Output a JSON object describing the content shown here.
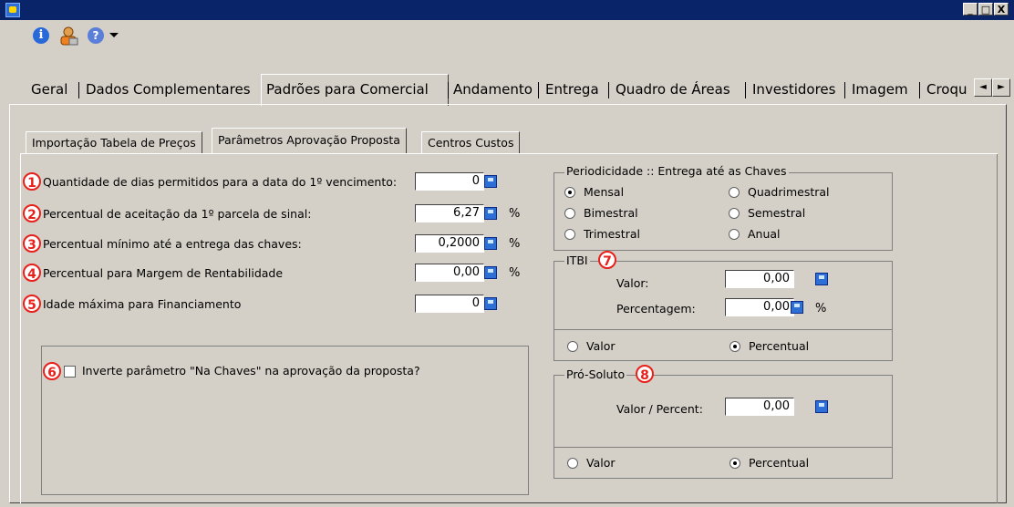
{
  "window": {
    "min_label": "_",
    "max_label": "□",
    "close_label": "X"
  },
  "toolbar": {
    "info_glyph": "i",
    "help_glyph": "?"
  },
  "tabs": [
    {
      "label": "Geral"
    },
    {
      "label": "Dados Complementares"
    },
    {
      "label": "Padrões para Comercial"
    },
    {
      "label": "Andamento"
    },
    {
      "label": "Entrega"
    },
    {
      "label": "Quadro de Áreas"
    },
    {
      "label": "Investidores"
    },
    {
      "label": "Imagem"
    },
    {
      "label": "Croqu"
    }
  ],
  "tab_scroll": {
    "left": "◄",
    "right": "►"
  },
  "subtabs": [
    {
      "label": "Importação Tabela de Preços"
    },
    {
      "label": "Parâmetros Aprovação Proposta"
    },
    {
      "label": "Centros Custos"
    }
  ],
  "fields": [
    {
      "badge": "1",
      "label": "Quantidade de dias permitidos para  a data do 1º vencimento:",
      "value": "0",
      "unit": ""
    },
    {
      "badge": "2",
      "label": "Percentual de aceitação da 1º parcela de sinal:",
      "value": "6,27",
      "unit": "%"
    },
    {
      "badge": "3",
      "label": "Percentual mínimo até a entrega das chaves:",
      "value": "0,2000",
      "unit": "%"
    },
    {
      "badge": "4",
      "label": "Percentual para Margem de Rentabilidade",
      "value": "0,00",
      "unit": "%"
    },
    {
      "badge": "5",
      "label": "Idade máxima para Financiamento",
      "value": "0",
      "unit": ""
    }
  ],
  "invert": {
    "badge": "6",
    "label": "Inverte parâmetro \"Na Chaves\" na aprovação da proposta?",
    "checked": false
  },
  "periodicidade": {
    "title": "Periodicidade :: Entrega até as Chaves",
    "options": [
      {
        "label": "Mensal",
        "selected": true
      },
      {
        "label": "Quadrimestral",
        "selected": false
      },
      {
        "label": "Bimestral",
        "selected": false
      },
      {
        "label": "Semestral",
        "selected": false
      },
      {
        "label": "Trimestral",
        "selected": false
      },
      {
        "label": "Anual",
        "selected": false
      }
    ]
  },
  "itbi": {
    "title": "ITBI",
    "badge": "7",
    "valor_label": "Valor:",
    "valor_value": "0,00",
    "percent_label": "Percentagem:",
    "percent_value": "0,00",
    "percent_unit": "%",
    "opt_valor": "Valor",
    "opt_percentual": "Percentual",
    "selected": "Percentual"
  },
  "prosoluto": {
    "title": "Pró-Soluto",
    "badge": "8",
    "value_label": "Valor / Percent:",
    "value": "0,00",
    "opt_valor": "Valor",
    "opt_percentual": "Percentual",
    "selected": "Percentual"
  },
  "colors": {
    "titlebar": "#0a246a",
    "window_bg": "#d4d0c8",
    "badge_red": "#e8201c"
  }
}
